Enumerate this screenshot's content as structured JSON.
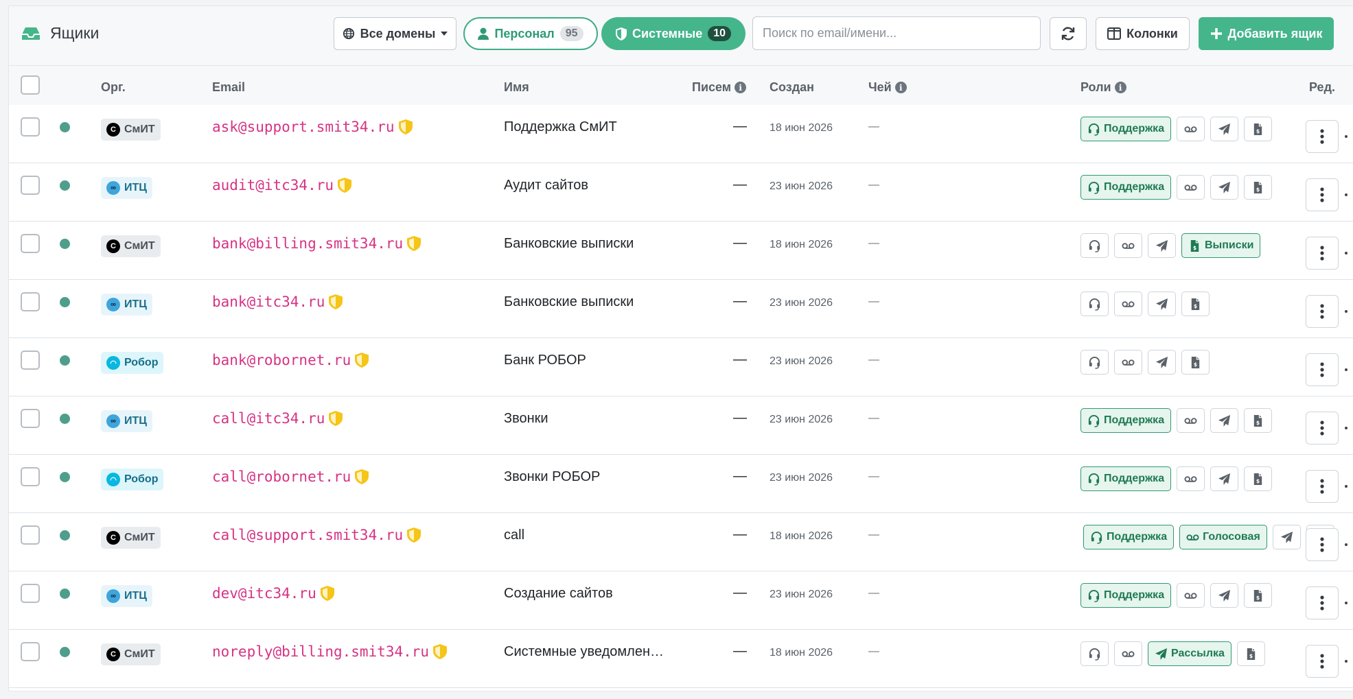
{
  "header": {
    "title": "Ящики",
    "domains_label": "Все домены",
    "personal_label": "Персонал",
    "personal_count": "95",
    "system_label": "Системные",
    "system_count": "10",
    "search_placeholder": "Поиск по email/имени...",
    "columns_label": "Колонки",
    "add_label": "Добавить ящик"
  },
  "columns": {
    "org": "Орг.",
    "email": "Email",
    "name": "Имя",
    "letters": "Писем",
    "created": "Создан",
    "whose": "Чей",
    "roles": "Роли",
    "edit": "Ред."
  },
  "rows": [
    {
      "org": "СмИТ",
      "email": "ask@support.smit34.ru",
      "name": "Поддержка СмИТ",
      "count": "—",
      "created": "18 июн 2026",
      "whose": "—"
    },
    {
      "org": "ИТЦ",
      "email": "audit@itc34.ru",
      "name": "Аудит сайтов",
      "count": "—",
      "created": "23 июн 2026",
      "whose": "—"
    },
    {
      "org": "СмИТ",
      "email": "bank@billing.smit34.ru",
      "name": "Банковские выписки",
      "count": "—",
      "created": "18 июн 2026",
      "whose": "—"
    },
    {
      "org": "ИТЦ",
      "email": "bank@itc34.ru",
      "name": "Банковские выписки",
      "count": "—",
      "created": "23 июн 2026",
      "whose": "—"
    },
    {
      "org": "Робор",
      "email": "bank@robornet.ru",
      "name": "Банк РОБОР",
      "count": "—",
      "created": "23 июн 2026",
      "whose": "—"
    },
    {
      "org": "ИТЦ",
      "email": "call@itc34.ru",
      "name": "Звонки",
      "count": "—",
      "created": "23 июн 2026",
      "whose": "—"
    },
    {
      "org": "Робор",
      "email": "call@robornet.ru",
      "name": "Звонки РОБОР",
      "count": "—",
      "created": "23 июн 2026",
      "whose": "—"
    },
    {
      "org": "СмИТ",
      "email": "call@support.smit34.ru",
      "name": "call",
      "count": "—",
      "created": "18 июн 2026",
      "whose": "—"
    },
    {
      "org": "ИТЦ",
      "email": "dev@itc34.ru",
      "name": "Создание сайтов",
      "count": "—",
      "created": "23 июн 2026",
      "whose": "—"
    },
    {
      "org": "СмИТ",
      "email": "noreply@billing.smit34.ru",
      "name": "Системные уведомлен…",
      "count": "—",
      "created": "18 июн 2026",
      "whose": "—"
    }
  ],
  "roles": {
    "support": "Поддержка",
    "voice": "Голосовая",
    "mailing": "Рассылка",
    "statements": "Выписки"
  },
  "colors": {
    "accent": "#45b58c",
    "email": "#d63384",
    "status_dot": "#4f9e8c",
    "shield": "#f5c518"
  }
}
